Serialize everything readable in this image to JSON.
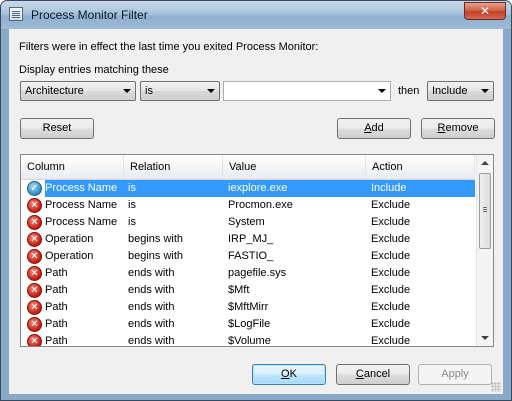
{
  "window": {
    "title": "Process Monitor Filter",
    "close_glyph": "✕"
  },
  "intro_text": "Filters were in effect the last time you exited Process Monitor:",
  "display_label": "Display entries matching these",
  "filter_builder": {
    "column_value": "Architecture",
    "relation_value": "is",
    "value_text": "",
    "then_label": "then",
    "action_value": "Include"
  },
  "buttons": {
    "reset": "Reset",
    "add_prefix": "",
    "add_accel": "A",
    "add_suffix": "dd",
    "remove_prefix": "",
    "remove_accel": "R",
    "remove_suffix": "emove",
    "ok_prefix": "",
    "ok_accel": "O",
    "ok_suffix": "K",
    "cancel_prefix": "",
    "cancel_accel": "C",
    "cancel_suffix": "ancel",
    "apply": "Apply"
  },
  "table": {
    "columns": [
      "Column",
      "Relation",
      "Value",
      "Action"
    ],
    "rows": [
      {
        "column": "Process Name",
        "relation": "is",
        "value": "iexplore.exe",
        "action": "Include",
        "icon": "check-icon",
        "selected": true
      },
      {
        "column": "Process Name",
        "relation": "is",
        "value": "Procmon.exe",
        "action": "Exclude",
        "icon": "x-icon",
        "selected": false
      },
      {
        "column": "Process Name",
        "relation": "is",
        "value": "System",
        "action": "Exclude",
        "icon": "x-icon",
        "selected": false
      },
      {
        "column": "Operation",
        "relation": "begins with",
        "value": "IRP_MJ_",
        "action": "Exclude",
        "icon": "x-icon",
        "selected": false
      },
      {
        "column": "Operation",
        "relation": "begins with",
        "value": "FASTIO_",
        "action": "Exclude",
        "icon": "x-icon",
        "selected": false
      },
      {
        "column": "Path",
        "relation": "ends with",
        "value": "pagefile.sys",
        "action": "Exclude",
        "icon": "x-icon",
        "selected": false
      },
      {
        "column": "Path",
        "relation": "ends with",
        "value": "$Mft",
        "action": "Exclude",
        "icon": "x-icon",
        "selected": false
      },
      {
        "column": "Path",
        "relation": "ends with",
        "value": "$MftMirr",
        "action": "Exclude",
        "icon": "x-icon",
        "selected": false
      },
      {
        "column": "Path",
        "relation": "ends with",
        "value": "$LogFile",
        "action": "Exclude",
        "icon": "x-icon",
        "selected": false
      },
      {
        "column": "Path",
        "relation": "ends with",
        "value": "$Volume",
        "action": "Exclude",
        "icon": "x-icon",
        "selected": false
      }
    ]
  },
  "colors": {
    "selection": "#3399ff",
    "exclude_icon": "#c4180c",
    "include_icon": "#2b8cc4"
  }
}
